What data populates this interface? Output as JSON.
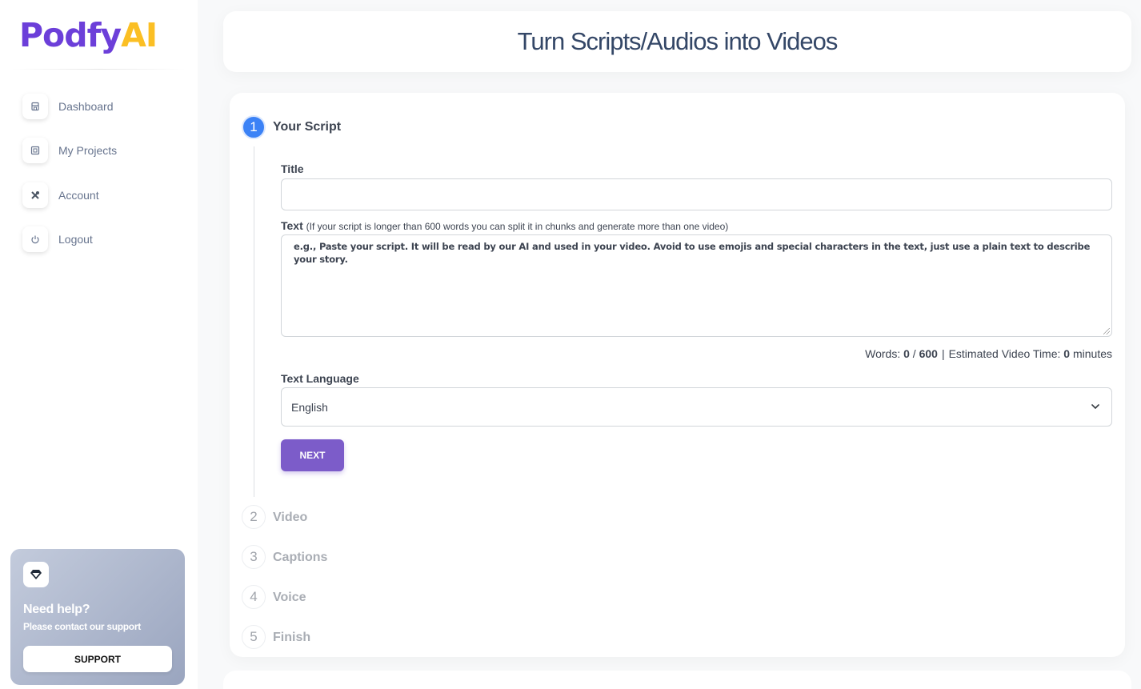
{
  "brand": {
    "name_part1": "Podfy",
    "name_part2": "AI"
  },
  "sidebar": {
    "items": [
      {
        "label": "Dashboard",
        "icon": "shop-icon"
      },
      {
        "label": "My Projects",
        "icon": "box-icon"
      },
      {
        "label": "Account",
        "icon": "tools-icon"
      },
      {
        "label": "Logout",
        "icon": "power-icon"
      }
    ],
    "help": {
      "title": "Need help?",
      "subtitle": "Please contact our support",
      "button": "SUPPORT",
      "icon": "diamond-icon"
    }
  },
  "header": {
    "title": "Turn Scripts/Audios into Videos"
  },
  "steps": [
    {
      "number": "1",
      "label": "Your Script",
      "active": true
    },
    {
      "number": "2",
      "label": "Video",
      "active": false
    },
    {
      "number": "3",
      "label": "Captions",
      "active": false
    },
    {
      "number": "4",
      "label": "Voice",
      "active": false
    },
    {
      "number": "5",
      "label": "Finish",
      "active": false
    }
  ],
  "form": {
    "title_label": "Title",
    "title_value": "",
    "text_label": "Text",
    "text_note": "(If your script is longer than 600 words you can split it in chunks and generate more than one video)",
    "text_placeholder": "e.g., Paste your script. It will be read by our AI and used in your video. Avoid to use emojis and special characters in the text, just use a plain text to describe your story.",
    "words_label": "Words:",
    "words_count": "0",
    "words_slash": "/",
    "words_max": "600",
    "separator": "|",
    "est_label": "Estimated Video Time:",
    "est_value": "0",
    "est_unit": "minutes",
    "language_label": "Text Language",
    "language_value": "English",
    "next_button": "NEXT"
  },
  "colors": {
    "brand_purple": "#6c3fd9",
    "brand_yellow": "#fbbf24",
    "step_active": "#3b82f6",
    "next_button": "#7c5cc9"
  }
}
